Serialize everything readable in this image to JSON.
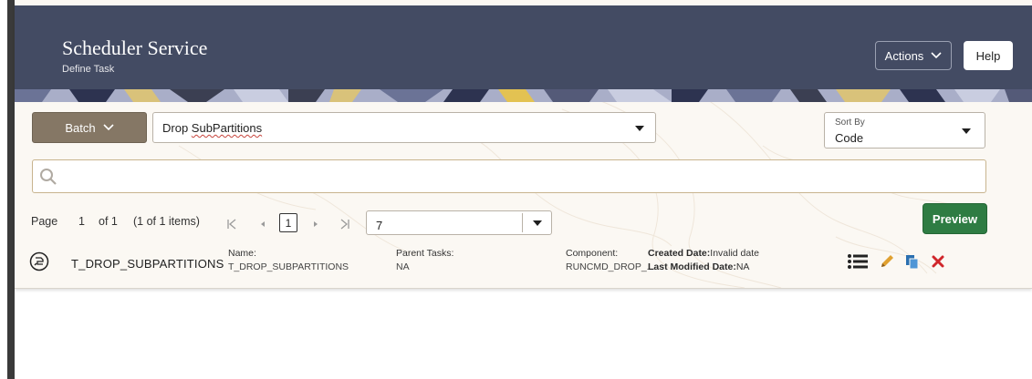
{
  "header": {
    "title": "Scheduler Service",
    "subtitle": "Define Task",
    "actions_label": "Actions",
    "help_label": "Help"
  },
  "filters": {
    "type_button": "Batch",
    "task_select_value_prefix": "Drop ",
    "task_select_value_word": "SubPartitions",
    "sort_by_label": "Sort By",
    "sort_by_value": "Code"
  },
  "search": {
    "placeholder": ""
  },
  "pagination": {
    "page_label": "Page",
    "current_page": "1",
    "of_label": "of 1",
    "items_summary": "(1 of 1 items)",
    "page_input_value": "1",
    "page_size_value": "7"
  },
  "preview_label": "Preview",
  "tasks": [
    {
      "code": "T_DROP_SUBPARTITIONS",
      "name_label": "Name:",
      "name_value": "T_DROP_SUBPARTITIONS",
      "parent_label": "Parent Tasks:",
      "parent_value": "NA",
      "component_label": "Component:",
      "component_value": "RUNCMD_DROP_...",
      "created_label": "Created Date:",
      "created_value": "Invalid date",
      "modified_label": "Last Modified Date:",
      "modified_value": "NA"
    }
  ],
  "colors": {
    "header_bg": "#434b63",
    "batch_button": "#857765",
    "preview_button": "#2e7c43",
    "edit_icon": "#e0a030",
    "copy_icon": "#2a6fb0",
    "delete_icon": "#d0262b"
  },
  "icons": {
    "actions_caret": "chevron-down-icon",
    "batch_caret": "chevron-down-icon",
    "search": "search-icon",
    "task_type": "process-icon",
    "details": "list-icon",
    "edit": "pencil-icon",
    "copy": "copy-icon",
    "delete": "close-icon"
  }
}
